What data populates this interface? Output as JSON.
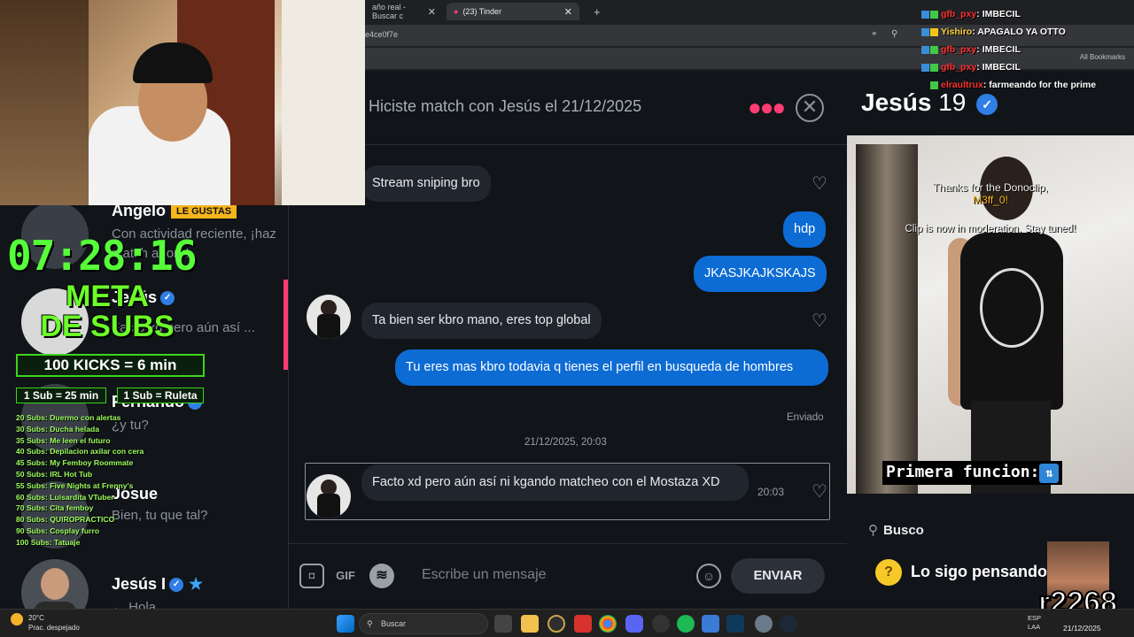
{
  "browser": {
    "tabs": [
      {
        "label": "año real - Buscar c",
        "active": false
      },
      {
        "label": "(23) Tinder",
        "active": true
      }
    ],
    "url": "e4ce0f7e",
    "bookmarks_label": "All Bookmarks"
  },
  "chat_list": {
    "items": [
      {
        "name": "Angelo",
        "badge": "LE GUSTAS",
        "snippet": "Con actividad reciente, ¡haz match ahora!"
      },
      {
        "name": "Jesús",
        "verified": true,
        "snippet": "Facto xd pero aún así ..."
      },
      {
        "name": "Fernando",
        "verified": true,
        "snippet": "¿y tu?"
      },
      {
        "name": "Josue",
        "snippet": "Bien, tu que tal?"
      },
      {
        "name": "Jesús I",
        "verified": true,
        "snippet": "← Hola"
      }
    ]
  },
  "overlay": {
    "timer": "07:28:16",
    "meta_line1": "META",
    "meta_line2": "DE SUBS",
    "kicks": "100 KICKS = 6 min",
    "sub_box1": "1 Sub = 25 min",
    "sub_box2": "1 Sub = Ruleta",
    "goals": [
      "20 Subs: Duermo con alertas",
      "30 Subs: Ducha helada",
      "35 Subs: Me leen el futuro",
      "40 Subs: Depilacion axilar con cera",
      "45 Subs: My Femboy Roommate",
      "50 Subs: IRL Hot Tub",
      "55 Subs: Five Nights at Frenny's",
      "60 Subs: Luisardita VTuber",
      "70 Subs: Cita femboy",
      "80 Subs: QUIROPRACTICO",
      "90 Subs: Cosplay furro",
      "100 Subs: Tatuaje"
    ]
  },
  "conversation": {
    "header": "Hiciste match con Jesús el 21/12/2025",
    "messages": [
      {
        "dir": "in",
        "text": "Stream sniping bro"
      },
      {
        "dir": "out",
        "text": "hdp"
      },
      {
        "dir": "out",
        "text": "JKASJKAJKSKAJS"
      },
      {
        "dir": "in",
        "text": "Ta bien ser kbro mano, eres top global"
      },
      {
        "dir": "out",
        "text": "Tu eres mas kbro todavia q tienes el perfil en busqueda de hombres"
      },
      {
        "dir": "in",
        "text": "Facto xd pero aún así ni kgando matcheo con el Mostaza XD",
        "time": "20:03"
      }
    ],
    "sent_label": "Enviado",
    "date_separator": "21/12/2025, 20:03"
  },
  "composer": {
    "gif_label": "GIF",
    "placeholder": "Escribe un mensaje",
    "send_label": "ENVIAR"
  },
  "profile": {
    "name": "Jesús",
    "age": "19",
    "donoclip_line1": "Thanks for the Donoclip,",
    "donoclip_user": "M3ff_0!",
    "moderation": "Clip is now in moderation. Stay tuned!",
    "primera": "Primera funcion:",
    "busco": "Busco",
    "sigo": "Lo sigo pensando"
  },
  "stream_chat": [
    {
      "user": "gfb_pxy",
      "user_color": "#ff3030",
      "text": "IMBECIL"
    },
    {
      "user": "Yishiro",
      "user_color": "#ffd23a",
      "text": "APAGALO YA OTTO"
    },
    {
      "user": "gfb_pxy",
      "user_color": "#ff3030",
      "text": "IMBECIL"
    },
    {
      "user": "gfb_pxy",
      "user_color": "#ff3030",
      "text": "IMBECIL"
    },
    {
      "user": "elraultrux",
      "user_color": "#ff3030",
      "text": "farmeando for the prime"
    }
  ],
  "watermark": "r2268",
  "taskbar": {
    "weather_temp": "20°C",
    "weather_desc": "Prac. despejado",
    "search_placeholder": "Buscar",
    "tray_lang1": "ESP",
    "tray_lang2": "LAA",
    "date": "21/12/2025"
  },
  "colors": {
    "accent": "#fe3c72",
    "bubble_out": "#0d6bd4",
    "bubble_in": "#21262e",
    "overlay_green": "#56ff3a"
  }
}
